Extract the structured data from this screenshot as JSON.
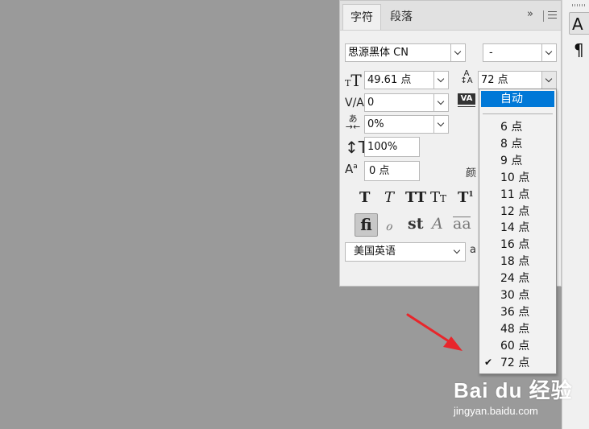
{
  "panel": {
    "tabs": [
      {
        "label": "字符",
        "active": true
      },
      {
        "label": "段落",
        "active": false
      }
    ],
    "overflow_icon": "»",
    "font_family": "思源黑体 CN",
    "font_style": "-",
    "font_size": "49.61 点",
    "leading": "72 点",
    "kerning": "0",
    "tracking_partial": "VA",
    "tsume": "0%",
    "vertical_scale": "100%",
    "baseline_shift": "0 点",
    "color_label_partial": "颜",
    "language": "美国英语",
    "antialias_partial": "a"
  },
  "dropdown": {
    "selected": "自动",
    "options": [
      {
        "label": "6 点",
        "checked": false
      },
      {
        "label": "8 点",
        "checked": false
      },
      {
        "label": "9 点",
        "checked": false
      },
      {
        "label": "10 点",
        "checked": false
      },
      {
        "label": "11 点",
        "checked": false
      },
      {
        "label": "12 点",
        "checked": false
      },
      {
        "label": "14 点",
        "checked": false
      },
      {
        "label": "16 点",
        "checked": false
      },
      {
        "label": "18 点",
        "checked": false
      },
      {
        "label": "24 点",
        "checked": false
      },
      {
        "label": "30 点",
        "checked": false
      },
      {
        "label": "36 点",
        "checked": false
      },
      {
        "label": "48 点",
        "checked": false
      },
      {
        "label": "60 点",
        "checked": false
      },
      {
        "label": "72 点",
        "checked": true
      }
    ]
  },
  "right_strip": {
    "char_button": "A",
    "paragraph_icon": "¶"
  },
  "watermark": {
    "brand": "Bai du 经验",
    "url": "jingyan.baidu.com"
  },
  "colors": {
    "accent": "#0078d7",
    "arrow": "#e8262b",
    "panel_bg": "#f0f0f0",
    "canvas": "#9a9a9a"
  }
}
